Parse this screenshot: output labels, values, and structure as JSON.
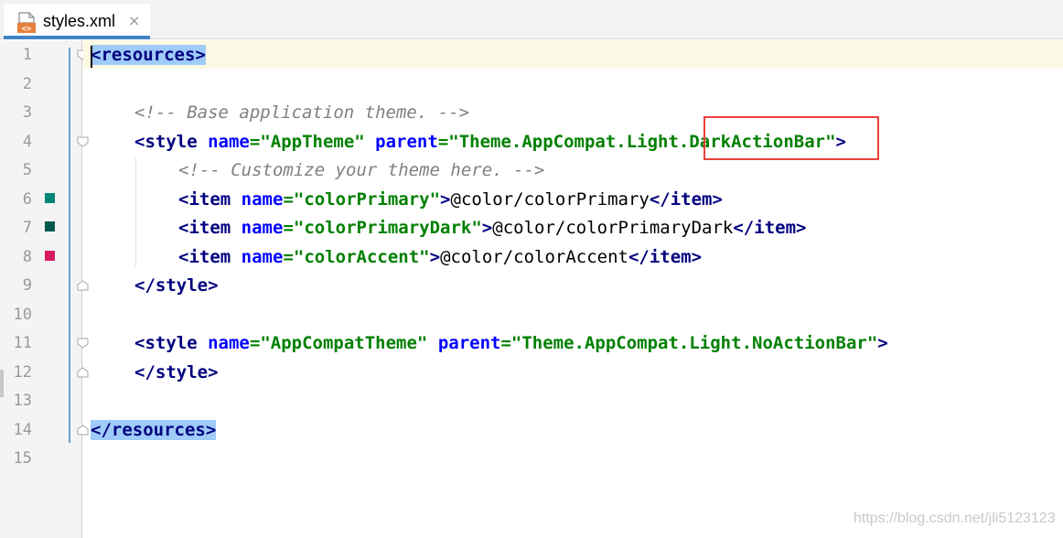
{
  "tab": {
    "filename": "styles.xml",
    "close_glyph": "×",
    "icon": "xml-file-icon"
  },
  "gutter": {
    "line_numbers": [
      "1",
      "2",
      "3",
      "4",
      "5",
      "6",
      "7",
      "8",
      "9",
      "10",
      "11",
      "12",
      "13",
      "14",
      "15"
    ],
    "color_swatches": [
      {
        "line": "6",
        "color": "#008577"
      },
      {
        "line": "7",
        "color": "#00574B"
      },
      {
        "line": "8",
        "color": "#D81B60"
      }
    ]
  },
  "code": {
    "l1_open": "<",
    "l1_tag": "resources",
    "l1_close": ">",
    "l3_comment": "<!-- Base application theme. -->",
    "l4_open": "<",
    "l4_tag": "style",
    "l4_attr1": "name",
    "l4_eq1": "=",
    "l4_val1": "\"AppTheme\"",
    "l4_attr2": "parent",
    "l4_eq2": "=",
    "l4_val2": "\"Theme.AppCompat.Light.DarkActionBar\"",
    "l4_close": ">",
    "l5_comment": "<!-- Customize your theme here. -->",
    "l6_open": "<",
    "l6_tag": "item",
    "l6_attr": "name",
    "l6_eq": "=",
    "l6_val": "\"colorPrimary\"",
    "l6_gt": ">",
    "l6_text": "@color/colorPrimary",
    "l6_end_open": "</",
    "l6_end_tag": "item",
    "l6_end_close": ">",
    "l7_open": "<",
    "l7_tag": "item",
    "l7_attr": "name",
    "l7_eq": "=",
    "l7_val": "\"colorPrimaryDark\"",
    "l7_gt": ">",
    "l7_text": "@color/colorPrimaryDark",
    "l7_end_open": "</",
    "l7_end_tag": "item",
    "l7_end_close": ">",
    "l8_open": "<",
    "l8_tag": "item",
    "l8_attr": "name",
    "l8_eq": "=",
    "l8_val": "\"colorAccent\"",
    "l8_gt": ">",
    "l8_text": "@color/colorAccent",
    "l8_end_open": "</",
    "l8_end_tag": "item",
    "l8_end_close": ">",
    "l9_open": "</",
    "l9_tag": "style",
    "l9_close": ">",
    "l11_open": "<",
    "l11_tag": "style",
    "l11_attr1": "name",
    "l11_eq1": "=",
    "l11_val1": "\"AppCompatTheme\"",
    "l11_attr2": "parent",
    "l11_eq2": "=",
    "l11_val2": "\"Theme.AppCompat.Light.NoActionBar\"",
    "l11_close": ">",
    "l12_open": "</",
    "l12_tag": "style",
    "l12_close": ">",
    "l14_open": "</",
    "l14_tag": "resources",
    "l14_close": ">"
  },
  "annotation": {
    "highlight_color": "#e8413c"
  },
  "watermark": "https://blog.csdn.net/jli5123123"
}
